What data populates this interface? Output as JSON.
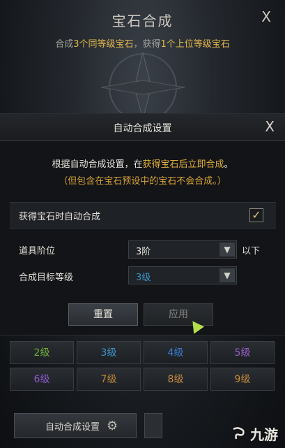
{
  "background": {
    "title": "宝石合成",
    "close": "X",
    "subtitle_parts": [
      "合成",
      "3个同等级宝石",
      "，获得",
      "1个上位等级宝石"
    ],
    "grades": [
      "2级",
      "3级",
      "4级",
      "5级",
      "6级",
      "7级",
      "8级",
      "9级"
    ],
    "auto_button_label": "自动合成设置"
  },
  "modal": {
    "title": "自动合成设置",
    "close": "X",
    "desc_line1_parts": [
      "根据自动合成设置，在",
      "获得宝石后立即合成",
      "。"
    ],
    "desc_line2": "（但包含在宝石预设中的宝石不会合成。）",
    "auto_label": "获得宝石时自动合成",
    "auto_checked": true,
    "item_tier_label": "道具阶位",
    "item_tier_value": "3阶",
    "item_tier_suffix": "以下",
    "target_label": "合成目标等级",
    "target_value": "3级",
    "reset_label": "重置",
    "apply_label": "应用"
  },
  "watermark": "九游",
  "colors": {
    "highlight": "#e2b03c",
    "target_value": "#3b94c8"
  }
}
